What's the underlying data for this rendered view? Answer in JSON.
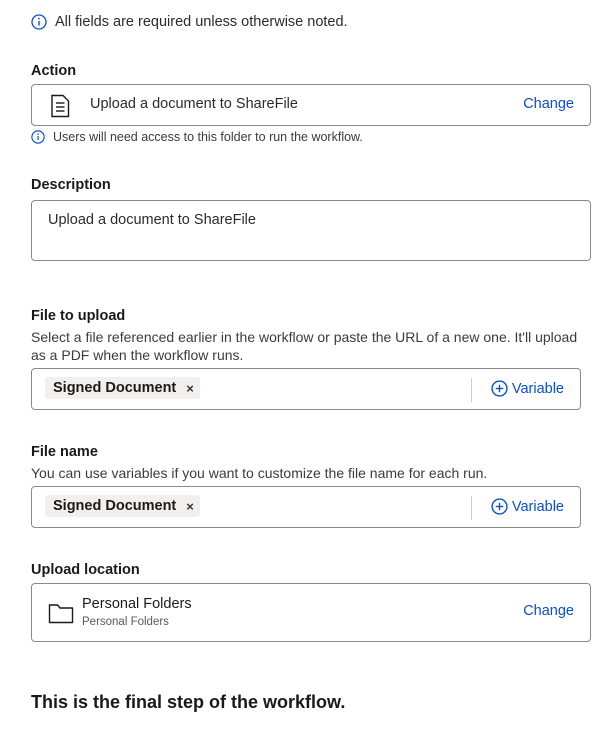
{
  "note": {
    "text": "All fields are required unless otherwise noted.",
    "icon": "info-icon"
  },
  "action": {
    "label": "Action",
    "value": "Upload a document to ShareFile",
    "change_label": "Change",
    "icon": "document-icon",
    "hint": "Users will need access to this folder to run the workflow."
  },
  "description": {
    "label": "Description",
    "value": "Upload a document to ShareFile"
  },
  "file_to_upload": {
    "label": "File to upload",
    "help": "Select a file referenced earlier in the workflow or paste the URL of a new one. It'll upload as a PDF when the workflow runs.",
    "chip": "Signed Document",
    "chip_remove": "×",
    "variable_label": "Variable"
  },
  "file_name": {
    "label": "File name",
    "help": "You can use variables if you want to customize the file name for each run.",
    "chip": "Signed Document",
    "chip_remove": "×",
    "variable_label": "Variable"
  },
  "upload_location": {
    "label": "Upload location",
    "title": "Personal Folders",
    "subtitle": "Personal Folders",
    "change_label": "Change",
    "icon": "folder-icon"
  },
  "final_step": "This is the final step of the workflow.",
  "colors": {
    "accent": "#0b50c8",
    "text": "#1e1919",
    "border": "#8a8a8a",
    "chip_bg": "#f1f0ee"
  }
}
